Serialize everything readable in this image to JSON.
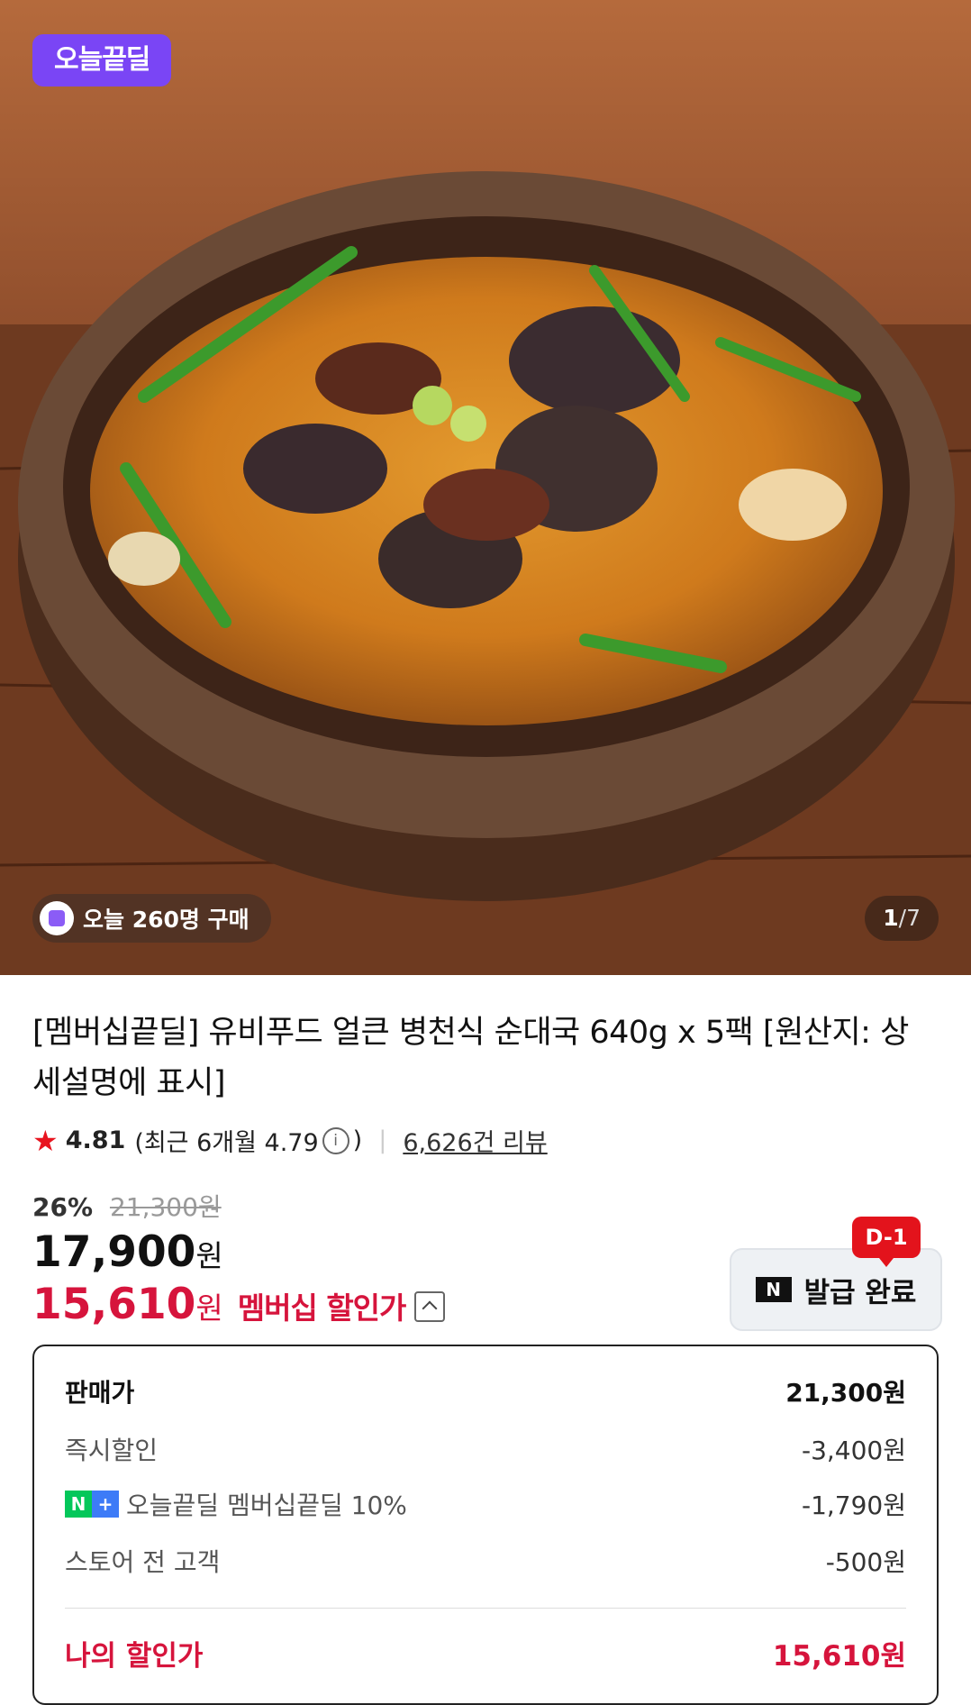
{
  "hero": {
    "deal_badge": "오늘끝딜",
    "buyers_text": "오늘 260명 구매",
    "buyers_icon": "shopping-bag-icon",
    "pager_current": "1",
    "pager_total": "/7"
  },
  "product": {
    "title": "[멤버십끝딜] 유비푸드 얼큰 병천식 순대국 640g x 5팩 [원산지: 상세설명에 표시]",
    "rating": "4.81",
    "recent_rating": "(최근 6개월 4.79",
    "recent_rating_close": ")",
    "review_count": "6,626건 리뷰",
    "discount_percent": "26%",
    "original_price": "21,300원",
    "price": "17,900",
    "price_unit": "원",
    "member_price": "15,610",
    "member_price_unit": "원",
    "member_label": "멤버십 할인가"
  },
  "coupon": {
    "dday": "D-1",
    "logo": "N",
    "label": "발급 완료"
  },
  "breakdown": {
    "sale_price_label": "판매가",
    "sale_price": "21,300원",
    "instant_label": "즉시할인",
    "instant_value": "-3,400원",
    "membership_label": "오늘끝딜 멤버십끝딜 10%",
    "membership_value": "-1,790원",
    "store_label": "스토어 전 고객",
    "store_value": "-500원",
    "final_label": "나의 할인가",
    "final_value": "15,610원"
  },
  "colors": {
    "accent_red": "#d6143c",
    "deal_purple": "#7a45f5",
    "naver_green": "#03c75a"
  }
}
